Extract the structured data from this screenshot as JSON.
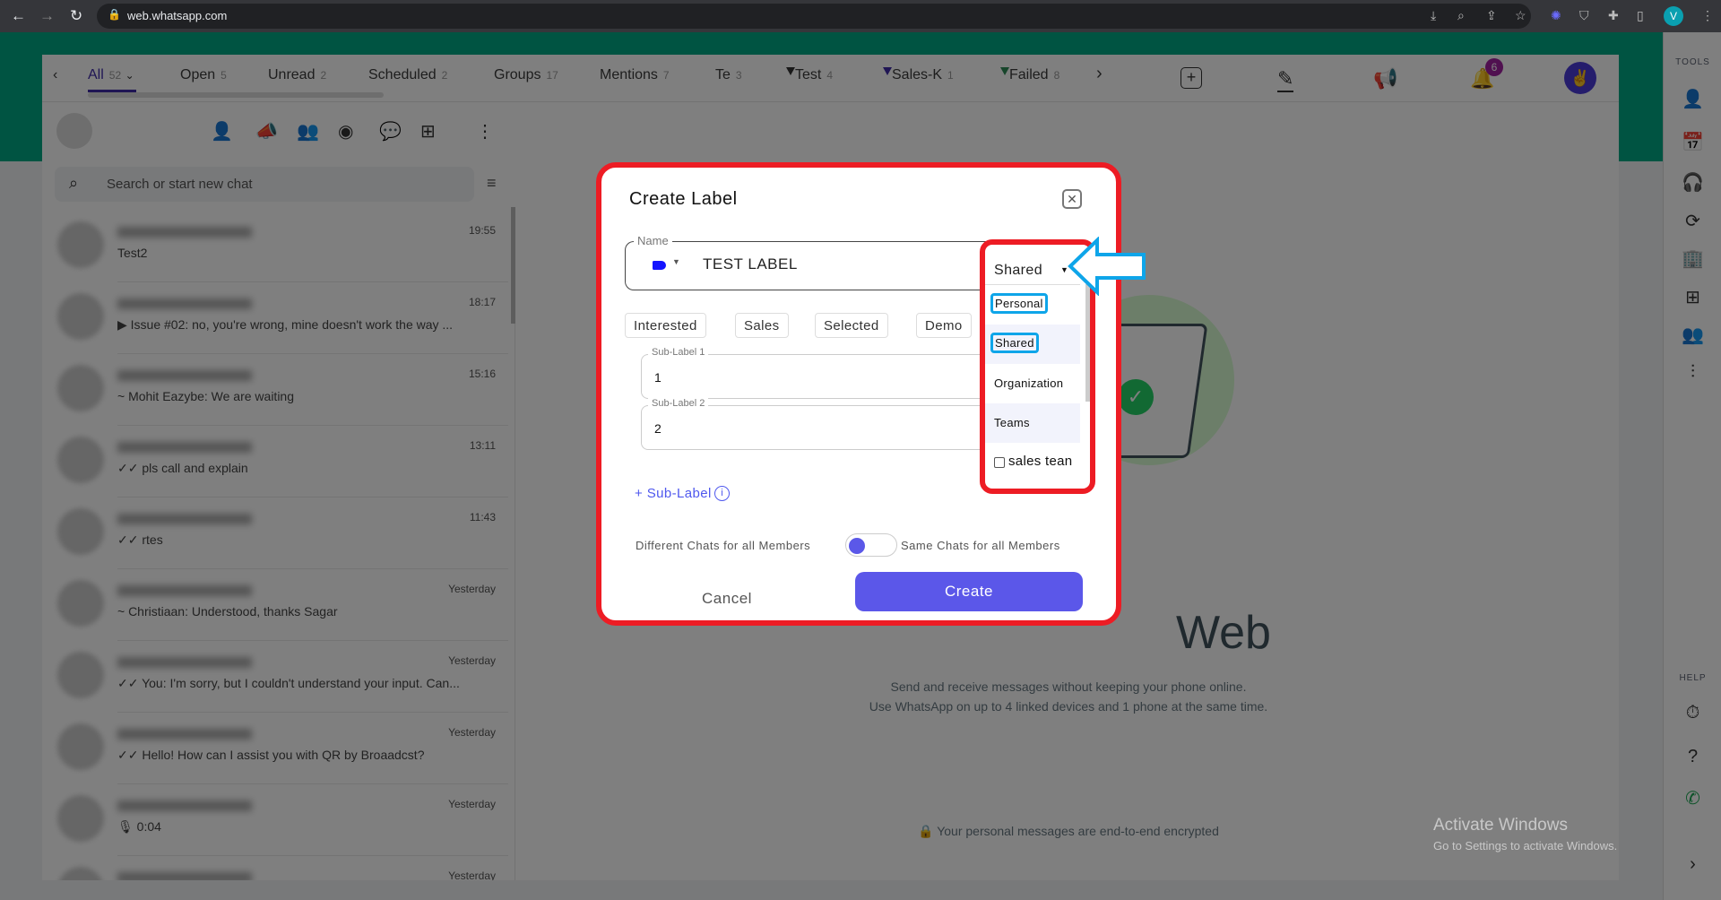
{
  "browser": {
    "url": "web.whatsapp.com",
    "profile_initial": "V"
  },
  "tabs": [
    {
      "label": "All",
      "count": "52",
      "active": true
    },
    {
      "label": "Open",
      "count": "5"
    },
    {
      "label": "Unread",
      "count": "2"
    },
    {
      "label": "Scheduled",
      "count": "2"
    },
    {
      "label": "Groups",
      "count": "17"
    },
    {
      "label": "Mentions",
      "count": "7"
    },
    {
      "label": "Te",
      "count": "3"
    },
    {
      "label": "Test",
      "count": "4",
      "filter_color": "#333333"
    },
    {
      "label": "Sales-K",
      "count": "1",
      "filter_color": "#3f2aa8"
    },
    {
      "label": "Failed",
      "count": "8",
      "filter_color": "#2e8b57"
    }
  ],
  "notifications_badge": "6",
  "search": {
    "placeholder": "Search or start new chat"
  },
  "chats": [
    {
      "time": "19:55",
      "preview": "Test2"
    },
    {
      "time": "18:17",
      "preview": "▶ Issue #02: no, you're wrong, mine doesn't work the way ..."
    },
    {
      "time": "15:16",
      "preview": "~ Mohit Eazybe: We are waiting"
    },
    {
      "time": "13:11",
      "preview": "✓✓ pls call and explain"
    },
    {
      "time": "11:43",
      "preview": "✓✓ rtes"
    },
    {
      "time": "Yesterday",
      "preview": "~ Christiaan: Understood, thanks Sagar"
    },
    {
      "time": "Yesterday",
      "preview": "✓✓ You: I'm sorry, but I couldn't understand your input. Can..."
    },
    {
      "time": "Yesterday",
      "preview": "✓✓ Hello! How can I assist you with QR by Broaadcst?"
    },
    {
      "time": "Yesterday",
      "preview": "🎙 0:04"
    },
    {
      "time": "Yesterday",
      "preview": ""
    }
  ],
  "main": {
    "title": "Web",
    "line1": "Send and receive messages without keeping your phone online.",
    "line2": "Use WhatsApp on up to 4 linked devices and 1 phone at the same time.",
    "encrypted": "🔒 Your personal messages are end-to-end encrypted"
  },
  "tools": {
    "tools_label": "TOOLS",
    "help_label": "HELP"
  },
  "windows": {
    "line1": "Activate Windows",
    "line2": "Go to Settings to activate Windows."
  },
  "dialog": {
    "title": "Create Label",
    "name_label": "Name",
    "name_value": "TEST LABEL",
    "tag_color": "#1414ff",
    "chips": [
      "Interested",
      "Sales",
      "Selected",
      "Demo"
    ],
    "sub_labels": [
      {
        "label": "Sub-Label 1",
        "value": "1"
      },
      {
        "label": "Sub-Label 2",
        "value": "2"
      }
    ],
    "add_sub_label": "+ Sub-Label",
    "toggle_left": "Different Chats for all Members",
    "toggle_right": "Same Chats for all Members",
    "cancel": "Cancel",
    "create": "Create",
    "visibility": {
      "selected": "Shared",
      "options": [
        "Personal",
        "Shared",
        "Organization",
        "Teams"
      ],
      "teams": [
        "sales tean"
      ]
    }
  }
}
